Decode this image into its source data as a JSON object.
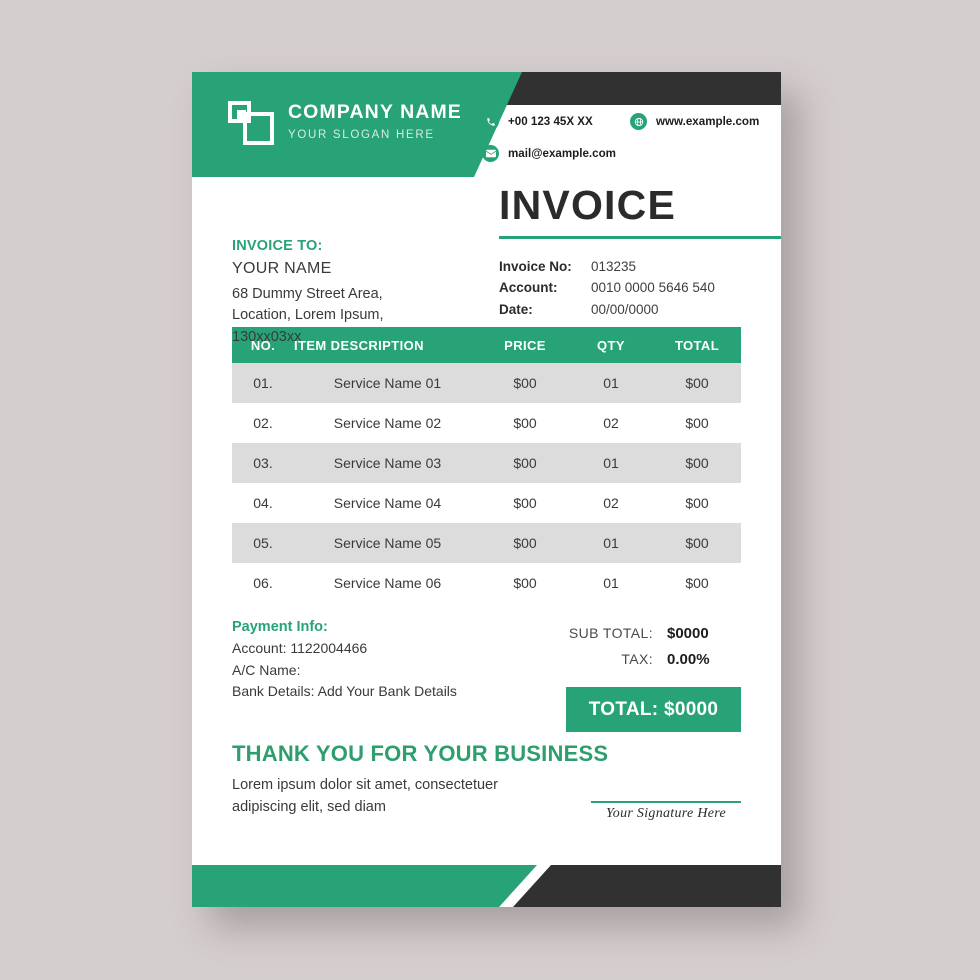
{
  "header": {
    "company_name": "COMPANY NAME",
    "slogan": "YOUR SLOGAN HERE",
    "logo_icon": "overlapping-squares-logo",
    "contacts": [
      {
        "icon": "phone-icon",
        "text": "+00 123 45X XX"
      },
      {
        "icon": "globe-icon",
        "text": "www.example.com"
      },
      {
        "icon": "envelope-icon",
        "text": "mail@example.com"
      }
    ]
  },
  "meta": {
    "title": "INVOICE",
    "invoice_to_label": "INVOICE TO:",
    "client_name": "YOUR NAME",
    "client_address": "68 Dummy Street Area,\nLocation, Lorem Ipsum,\n130xx03xx",
    "fields": [
      {
        "label": "Invoice No:",
        "value": "013235"
      },
      {
        "label": "Account:",
        "value": "0010 0000 5646 540"
      },
      {
        "label": "Date:",
        "value": "00/00/0000"
      }
    ]
  },
  "table": {
    "columns": [
      "NO.",
      "ITEM DESCRIPTION",
      "PRICE",
      "QTY",
      "TOTAL"
    ],
    "rows": [
      {
        "no": "01.",
        "desc": "Service Name 01",
        "price": "$00",
        "qty": "01",
        "total": "$00"
      },
      {
        "no": "02.",
        "desc": "Service Name 02",
        "price": "$00",
        "qty": "02",
        "total": "$00"
      },
      {
        "no": "03.",
        "desc": "Service Name 03",
        "price": "$00",
        "qty": "01",
        "total": "$00"
      },
      {
        "no": "04.",
        "desc": "Service Name 04",
        "price": "$00",
        "qty": "02",
        "total": "$00"
      },
      {
        "no": "05.",
        "desc": "Service Name 05",
        "price": "$00",
        "qty": "01",
        "total": "$00"
      },
      {
        "no": "06.",
        "desc": "Service Name 06",
        "price": "$00",
        "qty": "01",
        "total": "$00"
      }
    ]
  },
  "summary": {
    "subtotal_label": "SUB TOTAL:",
    "subtotal_value": "$0000",
    "tax_label": "TAX:",
    "tax_value": "0.00%",
    "total_text": "TOTAL: $0000"
  },
  "payment": {
    "title": "Payment Info:",
    "account": "Account: 1122004466",
    "ac_name": "A/C Name:",
    "bank_details": "Bank Details: Add Your Bank Details"
  },
  "thanks": {
    "title": "THANK YOU FOR YOUR BUSINESS",
    "body": "Lorem ipsum dolor sit amet, consectetuer adipiscing elit, sed diam",
    "signature_label": "Your Signature Here"
  },
  "colors": {
    "green": "#27a377",
    "dark": "#313131",
    "row_shade": "#dcdcdc",
    "page_background": "#d5cece"
  }
}
